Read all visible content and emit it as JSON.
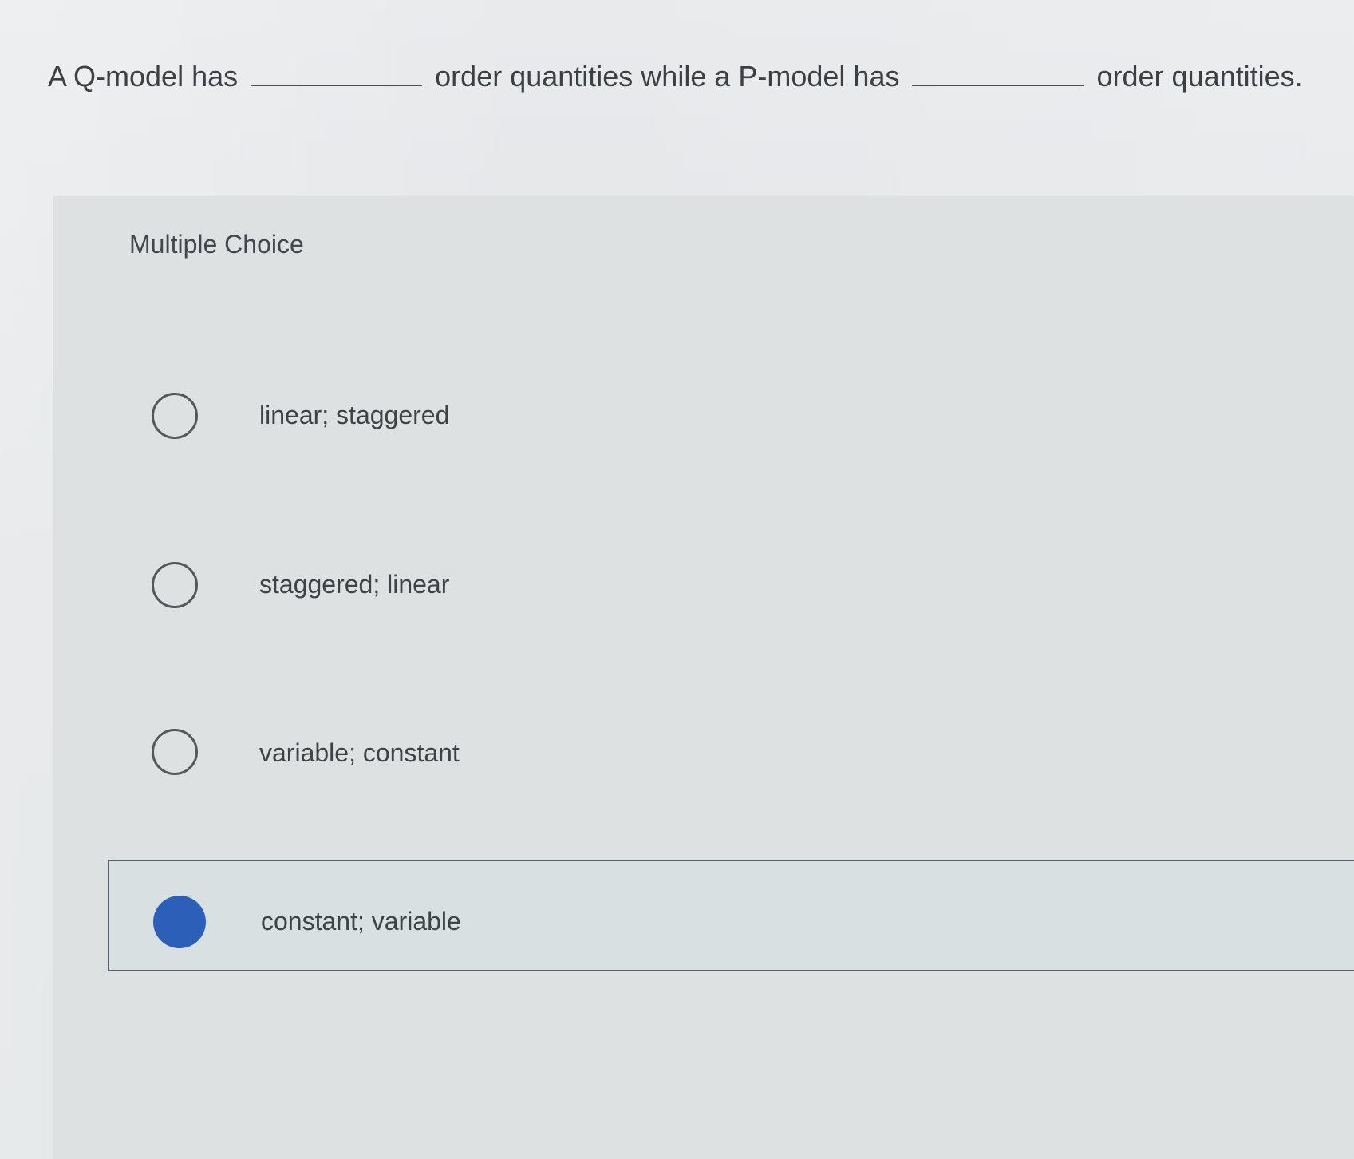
{
  "question": {
    "part1": "A Q-model has",
    "part2": "order quantities while a P-model has",
    "part3": "order quantities."
  },
  "multiple_choice": {
    "label": "Multiple Choice",
    "options": [
      {
        "label": "linear; staggered",
        "selected": false
      },
      {
        "label": "staggered; linear",
        "selected": false
      },
      {
        "label": "variable; constant",
        "selected": false
      },
      {
        "label": "constant; variable",
        "selected": true
      }
    ]
  },
  "colors": {
    "selected_radio": "#2c5fb8",
    "text": "#3b4045",
    "background": "#e4e7e8"
  }
}
